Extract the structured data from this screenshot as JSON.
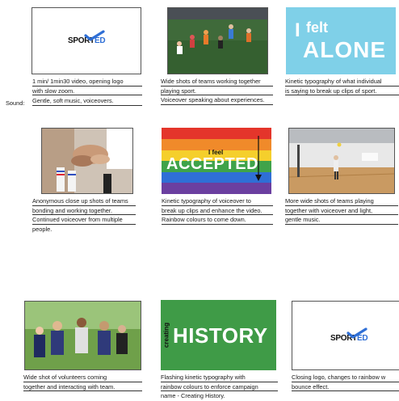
{
  "labels": {
    "sound": "Sound:"
  },
  "logo": {
    "part1": "SPORT",
    "part2": "ED"
  },
  "frames": [
    {
      "caption": [
        "1 min/ 1min30 video, opening logo",
        "with slow zoom."
      ],
      "sound": "Gentle, soft music, voiceovers."
    },
    {
      "caption": [
        "Wide shots of teams working together",
        "playing sport.",
        "Voiceover speaking about experiences."
      ]
    },
    {
      "graphic": {
        "line1": "I",
        "line2": "felt",
        "line3": "ALONE"
      },
      "caption": [
        "Kinetic typography of what individual",
        "is saying to break up clips of sport."
      ]
    },
    {
      "caption": [
        "Anonymous close up shots of teams",
        "bonding and working together.",
        "Continued voiceover from multiple",
        "people."
      ]
    },
    {
      "graphic": {
        "small": "I feel",
        "big": "ACCEPTED"
      },
      "caption": [
        "Kinetic typography of voiceover to",
        "break up clips and enhance the video.",
        "Rainbow colours to come down."
      ]
    },
    {
      "caption": [
        "More wide shots of teams playing",
        "together with voiceover and light,",
        "gentle music."
      ]
    },
    {
      "caption": [
        "Wide shot of volunteers coming",
        "together and interacting with team."
      ]
    },
    {
      "graphic": {
        "vertical": "creating",
        "big": "HISTORY"
      },
      "caption": [
        "Flashing kinetic typography with",
        "rainbow colours to enforce campaign",
        "name - Creating History."
      ]
    },
    {
      "caption": [
        "Closing logo, changes to rainbow w",
        "bounce effect."
      ]
    }
  ],
  "colors": {
    "alone_bg": "#7fd0e8",
    "history_bg": "#3f9b47",
    "logo_check": "#2f6fd6",
    "rainbow": [
      "#e4352b",
      "#f08a2a",
      "#f5cf2c",
      "#3fa34a",
      "#2f6fd6",
      "#6b3fa0"
    ]
  },
  "icons": [
    "check-icon",
    "arrow-down-icon"
  ]
}
